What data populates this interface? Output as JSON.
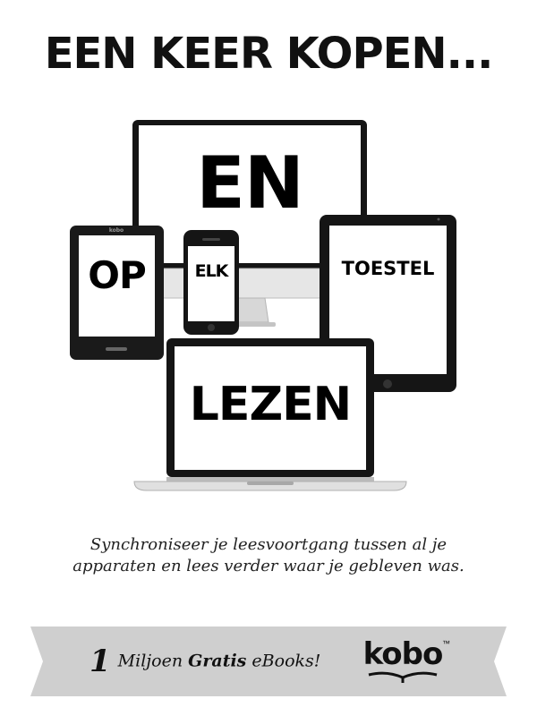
{
  "headline": "EEN KEER KOPEN...",
  "devices": {
    "monitor_word": "EN",
    "ereader_word": "OP",
    "phone_word": "ELK",
    "tablet_word": "TOESTEL",
    "laptop_word": "LEZEN",
    "ereader_brand": "kobo"
  },
  "tagline": {
    "line1": "Synchroniseer je leesvoortgang tussen al je",
    "line2": "apparaten en lees verder waar je gebleven was."
  },
  "banner": {
    "number": "1",
    "text_before": "Miljoen ",
    "text_bold": "Gratis",
    "text_after": " eBooks!",
    "logo_text": "kobo",
    "logo_tm": "™"
  },
  "colors": {
    "banner_bg": "#cfcfcf",
    "device_frame": "#151515",
    "screen": "#ffffff",
    "text": "#111111"
  }
}
